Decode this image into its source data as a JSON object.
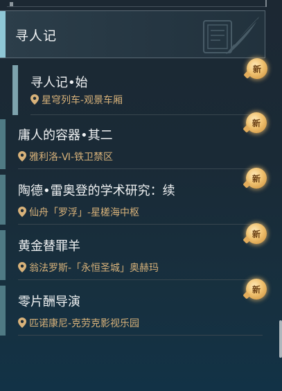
{
  "header": {
    "title": "寻人记"
  },
  "badge_label": "新",
  "quests": [
    {
      "name": "寻人记•始",
      "location": "星穹列车-观景车厢",
      "is_new": true
    },
    {
      "name": "庸人的容器•其二",
      "location": "雅利洛-Ⅵ-铁卫禁区",
      "is_new": true
    },
    {
      "name": "陶德•雷奥登的学术研究：续",
      "location": "仙舟「罗浮」-星槎海中枢",
      "is_new": true
    },
    {
      "name": "黄金替罪羊",
      "location": "翁法罗斯-「永恒圣城」奥赫玛",
      "is_new": true
    },
    {
      "name": "零片酬导演",
      "location": "匹诺康尼-克劳克影视乐园",
      "is_new": true
    }
  ],
  "colors": {
    "location_text": "#d8b27a",
    "accent": "#8fc7d6",
    "badge": "#f0c16f"
  }
}
